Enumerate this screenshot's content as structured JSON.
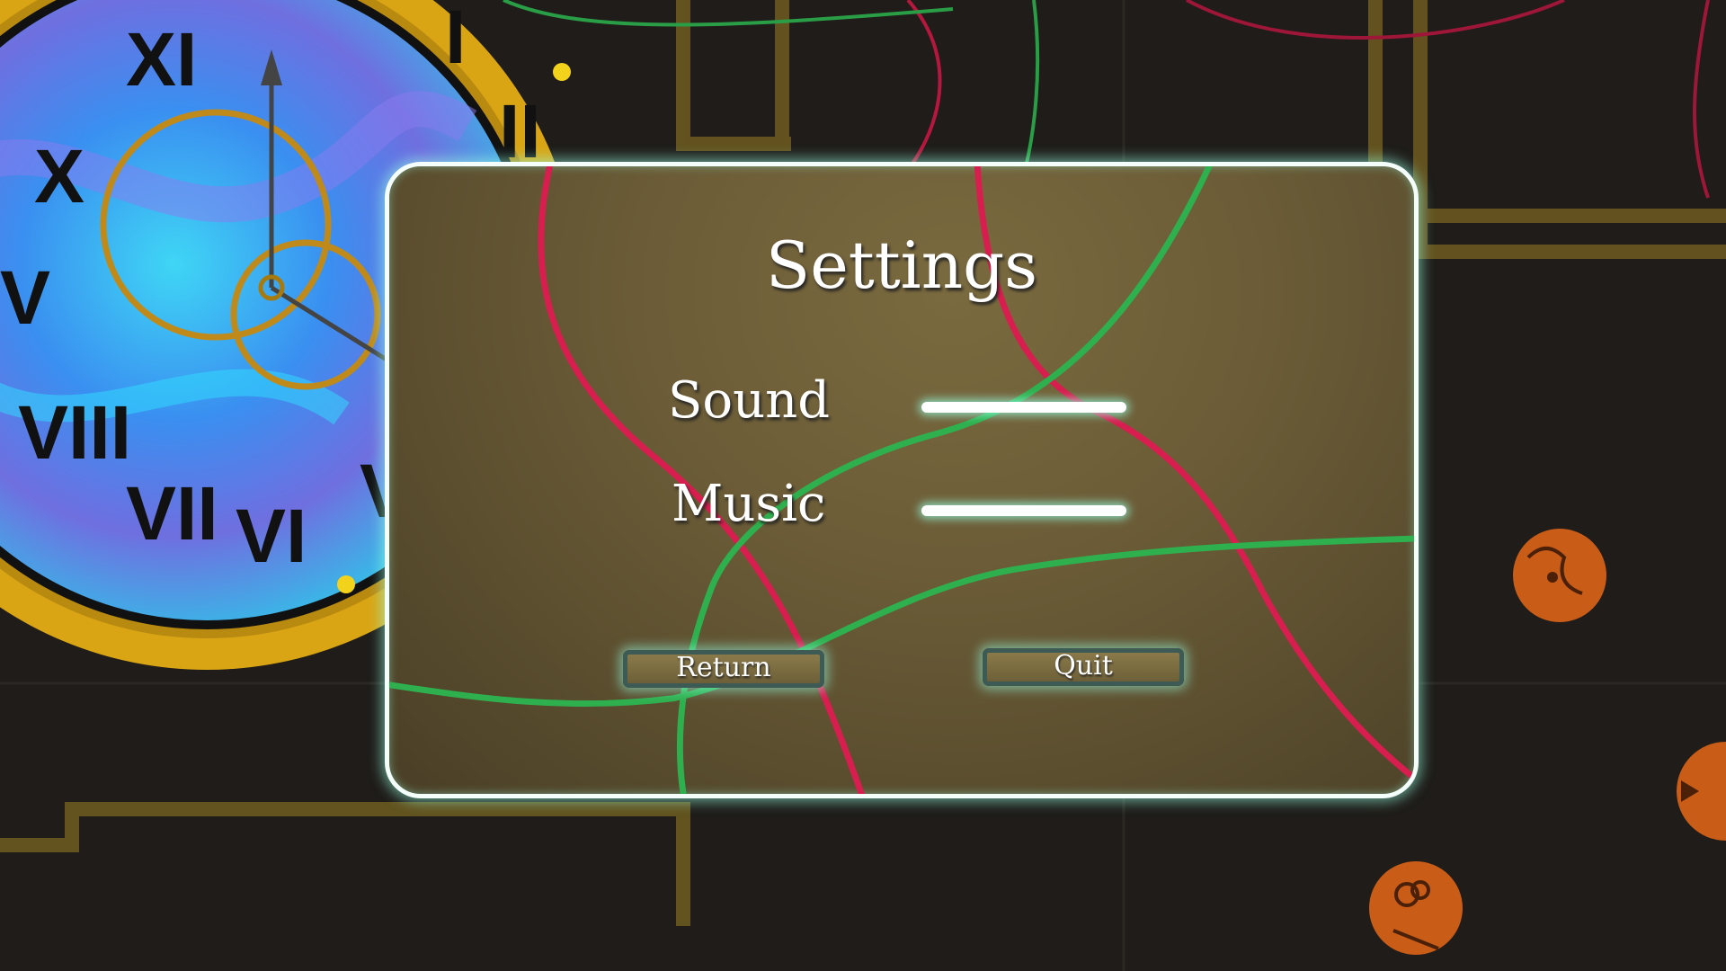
{
  "colors": {
    "background": "#1c1a17",
    "panel": "#6b5c37",
    "panel_border": "#f4fffb",
    "glow": "#96ffe1",
    "red_wire": "#d81d4f",
    "green_wire": "#2fb04f",
    "brass": "#d9a514",
    "clock_face": "#4fb8f0",
    "token": "#c95c17"
  },
  "clock": {
    "numerals": [
      "XI",
      "I",
      "II",
      "X",
      "V",
      "VIII",
      "VII",
      "VI",
      "V"
    ]
  },
  "settings": {
    "title": "Settings",
    "rows": [
      {
        "label": "Sound",
        "level": 1.0
      },
      {
        "label": "Music",
        "level": 1.0
      }
    ],
    "buttons": {
      "return_label": "Return",
      "quit_label": "Quit"
    }
  }
}
